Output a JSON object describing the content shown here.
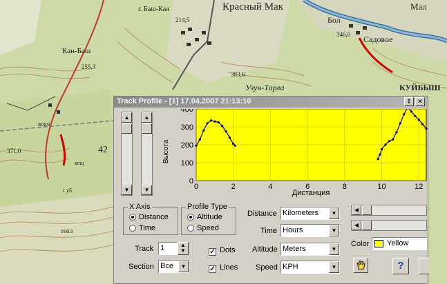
{
  "map": {
    "labels": [
      "г. Баш-Кая",
      "Красный Мак",
      "Бол",
      "Мал",
      "346,0",
      "Садовое",
      "Кан-Баш",
      "255,3",
      "214,5",
      "383,6",
      "Узун-Тарла",
      "КУЙБЫШ",
      "42",
      "вокч",
      "тепл",
      "1 уб",
      "вещ",
      "371,0"
    ]
  },
  "window": {
    "title": "Track Profile - [1] 17.04.2007 21:13:10",
    "restore_glyph": "⇕",
    "close_glyph": "✕"
  },
  "chart_data": {
    "type": "line",
    "xlabel": "Дистанция",
    "ylabel": "Высота",
    "xlim": [
      0,
      12.4
    ],
    "ylim": [
      0,
      400
    ],
    "xticks": [
      0,
      2,
      4,
      6,
      8,
      10,
      12
    ],
    "yticks": [
      0,
      100,
      200,
      300,
      400
    ],
    "background": "#ffff00",
    "line_color": "#000080",
    "grid": true,
    "series": [
      {
        "x": [
          0,
          0.2,
          0.4,
          0.6,
          0.8,
          1.0,
          1.2,
          1.4,
          1.6,
          1.8,
          2.0,
          2.1
        ],
        "y": [
          195,
          230,
          280,
          320,
          335,
          330,
          325,
          305,
          275,
          240,
          205,
          195
        ]
      },
      {
        "x": [
          9.8,
          9.9,
          10.0,
          10.2,
          10.4,
          10.6,
          10.8,
          11.0,
          11.2,
          11.4,
          11.6,
          11.8,
          12.0,
          12.2,
          12.4
        ],
        "y": [
          120,
          145,
          175,
          200,
          220,
          230,
          270,
          320,
          370,
          410,
          385,
          360,
          340,
          315,
          290
        ]
      }
    ]
  },
  "controls": {
    "x_axis": {
      "title": "X Axis",
      "options": [
        "Distance",
        "Time"
      ],
      "selected": 0
    },
    "profile_type": {
      "title": "Profile Type",
      "options": [
        "Altitude",
        "Speed"
      ],
      "selected": 0
    },
    "track": {
      "label": "Track",
      "value": "1"
    },
    "section": {
      "label": "Section",
      "value": "Все"
    },
    "dots": {
      "label": "Dots",
      "checked": true
    },
    "lines": {
      "label": "Lines",
      "checked": true
    },
    "distance": {
      "label": "Distance",
      "value": "Kilometers"
    },
    "time": {
      "label": "Time",
      "value": "Hours"
    },
    "altitude": {
      "label": "Altitude",
      "value": "Meters"
    },
    "speed": {
      "label": "Speed",
      "value": "KPH"
    },
    "color": {
      "label": "Color",
      "value": "Yellow",
      "swatch": "#ffff00"
    },
    "help_label": "?",
    "check_glyph": "✓",
    "arrow_glyph": "▼"
  }
}
